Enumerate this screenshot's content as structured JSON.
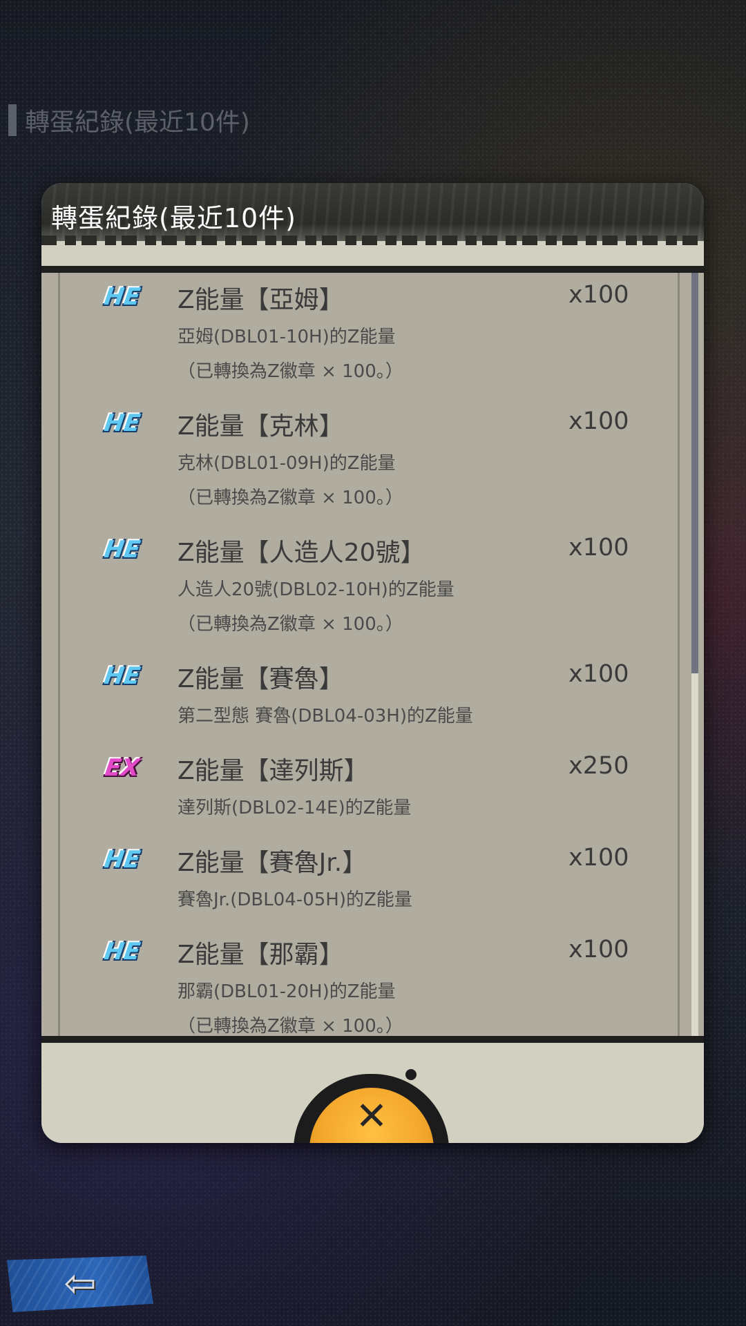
{
  "background_title": "轉蛋紀錄(最近10件)",
  "dialog": {
    "title": "轉蛋紀錄(最近10件)",
    "close_label": "✕"
  },
  "entries": [
    {
      "badge": "HE",
      "name": "Z能量【亞姆】",
      "qty": "x100",
      "desc": "亞姆(DBL01-10H)的Z能量",
      "note": "（已轉換為Z徽章 × 100。）"
    },
    {
      "badge": "HE",
      "name": "Z能量【克林】",
      "qty": "x100",
      "desc": "克林(DBL01-09H)的Z能量",
      "note": "（已轉換為Z徽章 × 100。）"
    },
    {
      "badge": "HE",
      "name": "Z能量【人造人20號】",
      "qty": "x100",
      "desc": "人造人20號(DBL02-10H)的Z能量",
      "note": "（已轉換為Z徽章 × 100。）"
    },
    {
      "badge": "HE",
      "name": "Z能量【賽魯】",
      "qty": "x100",
      "desc": "第二型態 賽魯(DBL04-03H)的Z能量",
      "note": ""
    },
    {
      "badge": "EX",
      "name": "Z能量【達列斯】",
      "qty": "x250",
      "desc": "達列斯(DBL02-14E)的Z能量",
      "note": ""
    },
    {
      "badge": "HE",
      "name": "Z能量【賽魯Jr.】",
      "qty": "x100",
      "desc": "賽魯Jr.(DBL04-05H)的Z能量",
      "note": ""
    },
    {
      "badge": "HE",
      "name": "Z能量【那霸】",
      "qty": "x100",
      "desc": "那霸(DBL01-20H)的Z能量",
      "note": "（已轉換為Z徽章 × 100。）"
    }
  ],
  "back_button": {
    "icon": "back-arrow-icon",
    "glyph": "⇦"
  },
  "colors": {
    "he_badge": "#5ec8f0",
    "ex_badge": "#e24ac8",
    "close_button": "#f3a52b",
    "back_button": "#2c66b8"
  }
}
